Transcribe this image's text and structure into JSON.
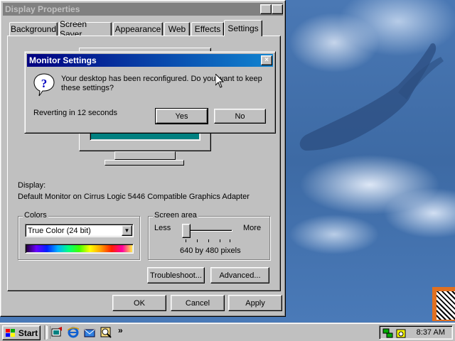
{
  "desktop": {},
  "display_properties": {
    "title": "Display Properties",
    "help_btn": "?",
    "close_btn": "×",
    "tabs": [
      {
        "label": "Background"
      },
      {
        "label": "Screen Saver"
      },
      {
        "label": "Appearance"
      },
      {
        "label": "Web"
      },
      {
        "label": "Effects"
      },
      {
        "label": "Settings",
        "active": true
      }
    ],
    "display_label": "Display:",
    "display_value": "Default Monitor on Cirrus Logic 5446 Compatible Graphics Adapter",
    "colors": {
      "legend": "Colors",
      "selected": "True Color (24 bit)"
    },
    "screen_area": {
      "legend": "Screen area",
      "less": "Less",
      "more": "More",
      "value": "640 by 480 pixels",
      "slider_position": 0
    },
    "troubleshoot_label": "Troubleshoot...",
    "advanced_label": "Advanced...",
    "ok_label": "OK",
    "cancel_label": "Cancel",
    "apply_label": "Apply"
  },
  "monitor_settings": {
    "title": "Monitor Settings",
    "close_btn": "×",
    "message": "Your desktop has been reconfigured.  Do you want to keep these settings?",
    "countdown": "Reverting in 12 seconds",
    "yes_label": "Yes",
    "no_label": "No"
  },
  "taskbar": {
    "start_label": "Start",
    "quick_launch": [
      "show-desktop-icon",
      "internet-explorer-icon",
      "outlook-express-icon",
      "channels-icon"
    ],
    "chevron": "»",
    "clock": "8:37 AM"
  },
  "colors": {
    "titlebar_active_start": "#000080",
    "titlebar_active_end": "#1084d0",
    "titlebar_inactive": "#808080",
    "face": "#c0c0c0",
    "desktop": "#3f6fa8"
  }
}
